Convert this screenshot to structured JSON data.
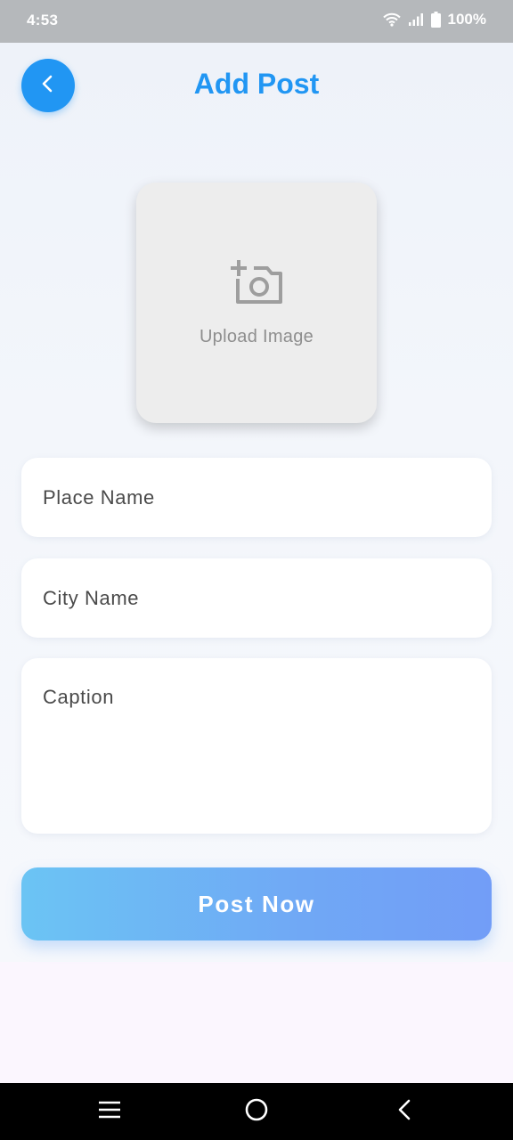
{
  "status_bar": {
    "time": "4:53",
    "battery_percent": "100%",
    "icons": [
      "wifi-icon",
      "signal-icon",
      "battery-icon"
    ]
  },
  "header": {
    "title": "Add Post",
    "back_icon": "chevron-left-icon"
  },
  "upload": {
    "label": "Upload Image",
    "icon": "add-photo-camera-icon"
  },
  "form": {
    "place_name_placeholder": "Place Name",
    "city_name_placeholder": "City Name",
    "caption_placeholder": "Caption",
    "place_name_value": "",
    "city_name_value": "",
    "caption_value": ""
  },
  "submit": {
    "label": "Post Now"
  },
  "nav_bar": {
    "items": [
      "menu-icon",
      "home-icon",
      "back-icon"
    ]
  },
  "colors": {
    "accent": "#2196f3",
    "button_gradient_start": "#6bc4f4",
    "button_gradient_end": "#729df7",
    "status_bar": "#b5b8bb",
    "upload_box": "#ededed"
  }
}
